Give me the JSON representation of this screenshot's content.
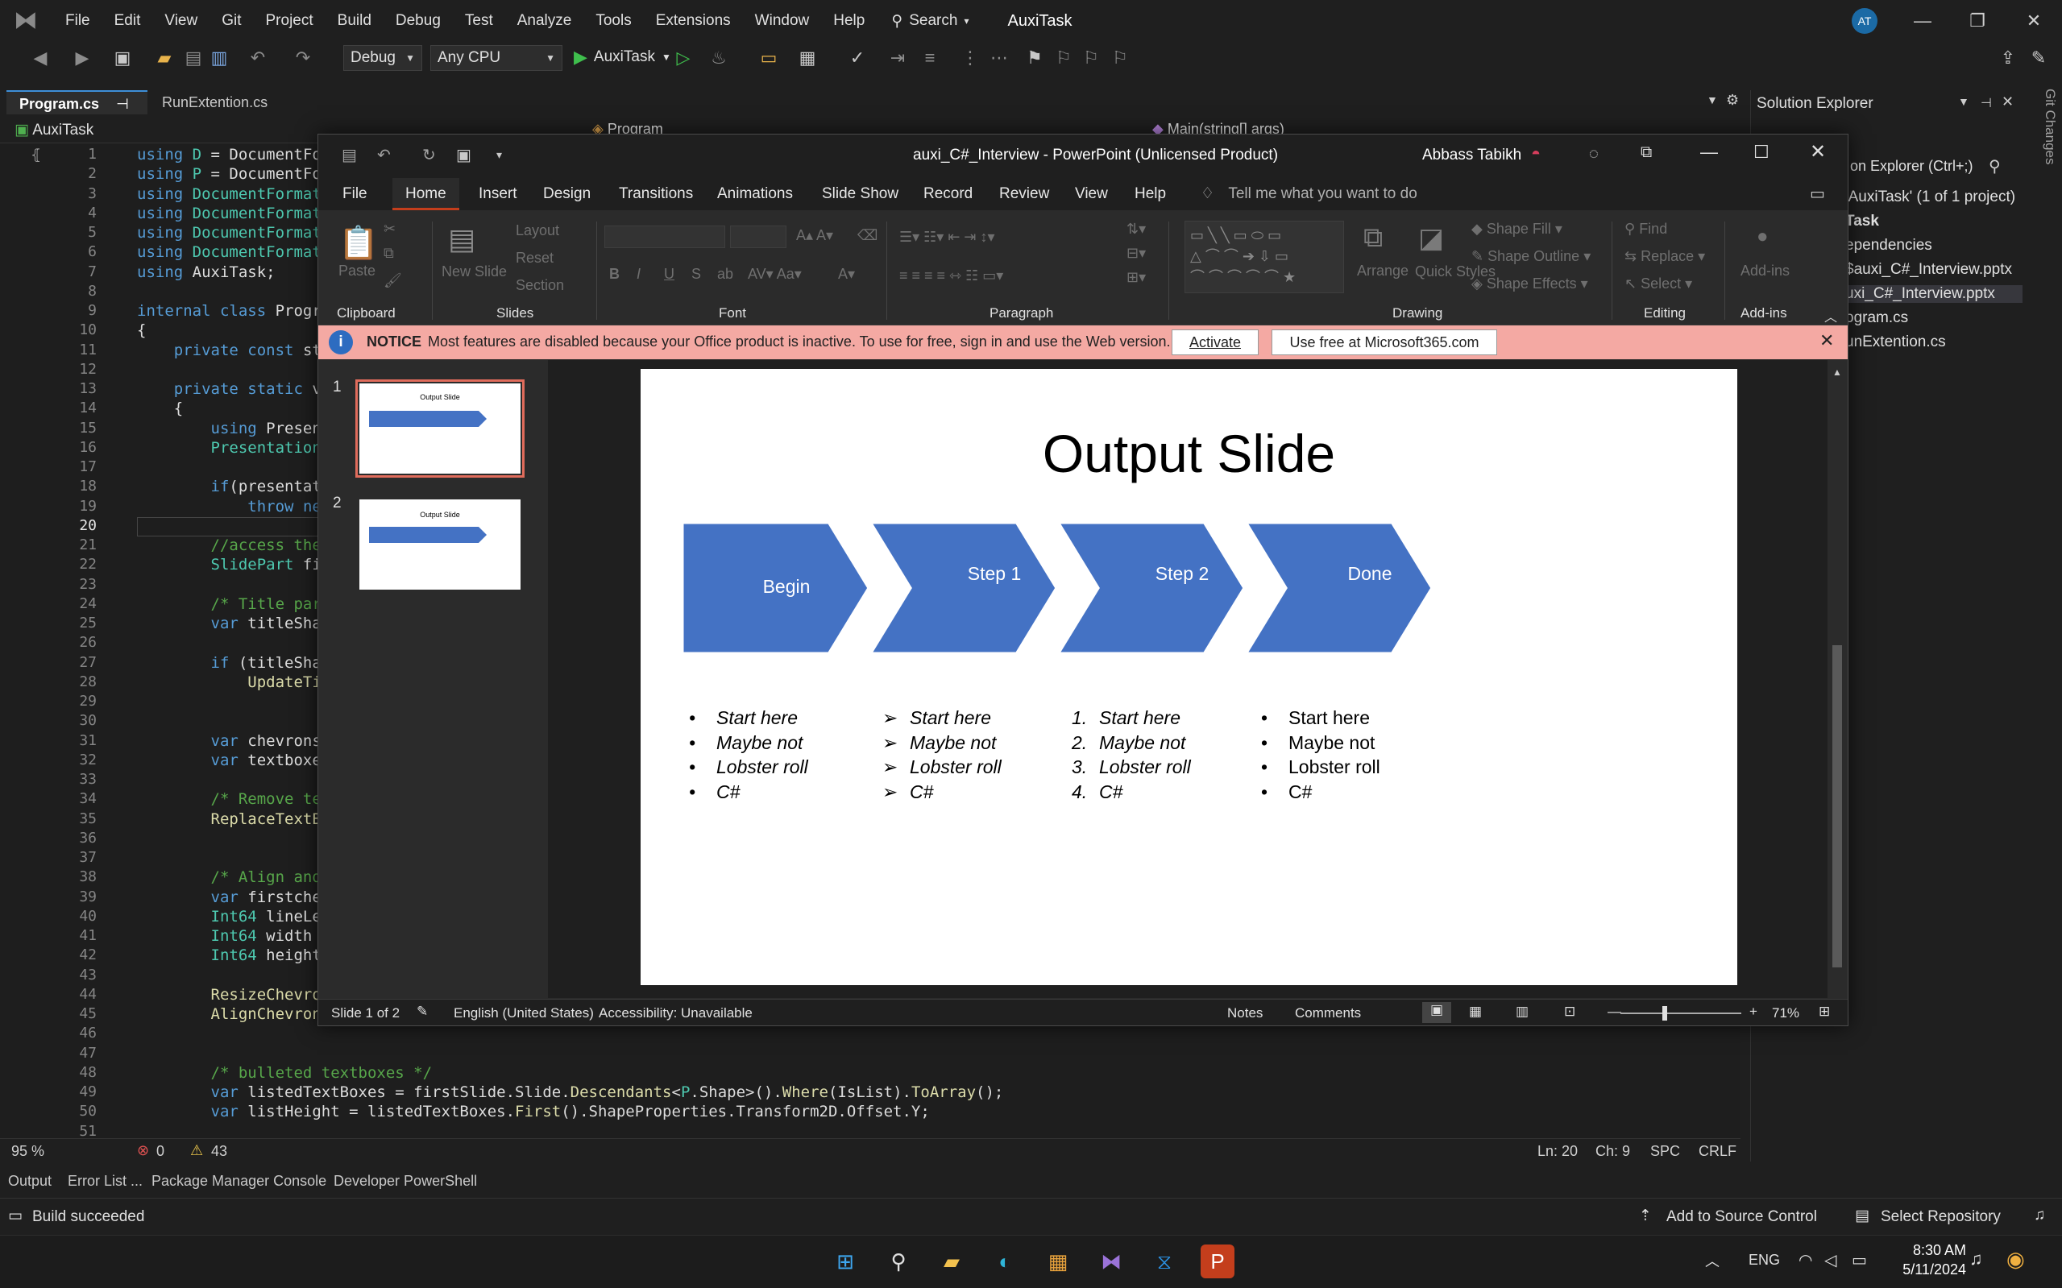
{
  "vs": {
    "menu": [
      "File",
      "Edit",
      "View",
      "Git",
      "Project",
      "Build",
      "Debug",
      "Test",
      "Analyze",
      "Tools",
      "Extensions",
      "Window",
      "Help"
    ],
    "search_label": "Search",
    "title": "AuxiTask",
    "account_initials": "AT",
    "toolbar": {
      "config": "Debug",
      "platform": "Any CPU",
      "run_target": "AuxiTask"
    },
    "tabs": [
      "Program.cs",
      "RunExtention.cs"
    ],
    "nav_project": "AuxiTask",
    "nav_class": "Program",
    "nav_member": "Main(string[] args)",
    "line_numbers": [
      "1",
      "2",
      "3",
      "4",
      "5",
      "6",
      "7",
      "8",
      "9",
      "10",
      "11",
      "12",
      "13",
      "14",
      "15",
      "16",
      "17",
      "18",
      "19",
      "20",
      "21",
      "22",
      "23",
      "24",
      "25",
      "26",
      "27",
      "28",
      "29",
      "30",
      "31",
      "32",
      "33",
      "34",
      "35",
      "36",
      "37",
      "38",
      "39",
      "40",
      "41",
      "42",
      "43",
      "44",
      "45",
      "46",
      "47",
      "48",
      "49",
      "50",
      "51"
    ],
    "current_line": "20",
    "code": [
      "using D = DocumentFor",
      "using P = DocumentFor",
      "using DocumentFormat",
      "using DocumentFormat",
      "using DocumentFormat",
      "using DocumentFormat",
      "using AuxiTask;",
      "",
      "internal class Progra",
      "{",
      "    private const st",
      "",
      "    private static vo",
      "    {",
      "        using Present",
      "        Presentation",
      "",
      "        if(presentat:",
      "            throw new",
      "",
      "        //access the",
      "        SlidePart fi",
      "",
      "        /* Title part",
      "        var titleShap",
      "",
      "        if (titleShap",
      "            UpdateTit",
      "",
      "",
      "        var chevrons",
      "        var textboxes",
      "",
      "        /* Remove tex",
      "        ReplaceTextBo",
      "",
      "",
      "        /* Align and",
      "        var firstchev",
      "        Int64 lineLev",
      "        Int64 width =",
      "        Int64 height",
      "",
      "        ResizeChevron",
      "        AlignChevrons(chevrons, lineLevel);",
      "",
      "",
      "        /* bulleted textboxes */",
      "        var listedTextBoxes = firstSlide.Slide.Descendants<P.Shape>().Where(IsList).ToArray();",
      "        var listHeight = listedTextBoxes.First().ShapeProperties.Transform2D.Offset.Y;",
      ""
    ],
    "editor_status": {
      "zoom": "95 %",
      "errors": "0",
      "warnings": "43",
      "ln": "Ln: 20",
      "ch": "Ch: 9",
      "spc": "SPC",
      "crlf": "CRLF"
    },
    "tool_tabs": [
      "Output",
      "Error List ...",
      "Package Manager Console",
      "Developer PowerShell"
    ],
    "status": {
      "build": "Build succeeded",
      "source_control": "Add to Source Control",
      "repo": "Select Repository"
    },
    "solution": {
      "title": "Solution Explorer",
      "search_placeholder": "on Explorer (Ctrl+;)",
      "items": [
        "'AuxiTask' (1 of 1 project)",
        "Task",
        "ependencies",
        "$auxi_C#_Interview.pptx",
        "uxi_C#_Interview.pptx",
        "ogram.cs",
        "unExtention.cs"
      ]
    },
    "git_changes": "Git Changes"
  },
  "ppt": {
    "title": "auxi_C#_Interview  -  PowerPoint (Unlicensed Product)",
    "user": "Abbass Tabikh",
    "tabs": [
      "File",
      "Home",
      "Insert",
      "Design",
      "Transitions",
      "Animations",
      "Slide Show",
      "Record",
      "Review",
      "View",
      "Help"
    ],
    "tell_me": "Tell me what you want to do",
    "ribbon_groups": [
      "Clipboard",
      "Slides",
      "Font",
      "Paragraph",
      "Drawing",
      "Editing",
      "Add-ins"
    ],
    "ribbon_buttons": {
      "paste": "Paste",
      "new_slide": "New Slide",
      "layout": "Layout",
      "reset": "Reset",
      "section": "Section",
      "arrange": "Arrange",
      "quick_styles": "Quick Styles",
      "shape_fill": "Shape Fill",
      "shape_outline": "Shape Outline",
      "shape_effects": "Shape Effects",
      "find": "Find",
      "replace": "Replace",
      "select": "Select",
      "add_ins": "Add-ins"
    },
    "notice": {
      "title": "NOTICE",
      "text": "Most features are disabled because your Office product is inactive. To use for free, sign in and use the Web version.",
      "activate": "Activate",
      "use_free": "Use free at Microsoft365.com"
    },
    "slide": {
      "title": "Output Slide",
      "chevrons": [
        "Begin",
        "Step 1",
        "Step 2",
        "Done"
      ],
      "lists": [
        {
          "markers": [
            "•",
            "•",
            "•",
            "•"
          ],
          "items": [
            "Start here",
            "Maybe not",
            "Lobster roll",
            "C#"
          ]
        },
        {
          "markers": [
            "➢",
            "➢",
            "➢",
            "➢"
          ],
          "items": [
            "Start here",
            "Maybe not",
            "Lobster roll",
            "C#"
          ]
        },
        {
          "markers": [
            "1.",
            "2.",
            "3.",
            "4."
          ],
          "items": [
            "Start here",
            "Maybe not",
            "Lobster roll",
            "C#"
          ]
        },
        {
          "markers": [
            "•",
            "•",
            "•",
            "•"
          ],
          "items": [
            "Start here",
            "Maybe not",
            "Lobster roll",
            "C#"
          ]
        }
      ]
    },
    "thumb_numbers": [
      "1",
      "2"
    ],
    "thumb_title": "Output Slide",
    "status": {
      "slide": "Slide 1 of 2",
      "language": "English (United States)",
      "accessibility": "Accessibility: Unavailable",
      "notes": "Notes",
      "comments": "Comments",
      "zoom": "71%"
    }
  },
  "taskbar": {
    "lang": "ENG",
    "time": "8:30 AM",
    "date": "5/11/2024"
  },
  "colors": {
    "chevron": "#4472c4",
    "accent_ppt": "#c43e1c",
    "notice_bg": "#f4a9a3"
  }
}
